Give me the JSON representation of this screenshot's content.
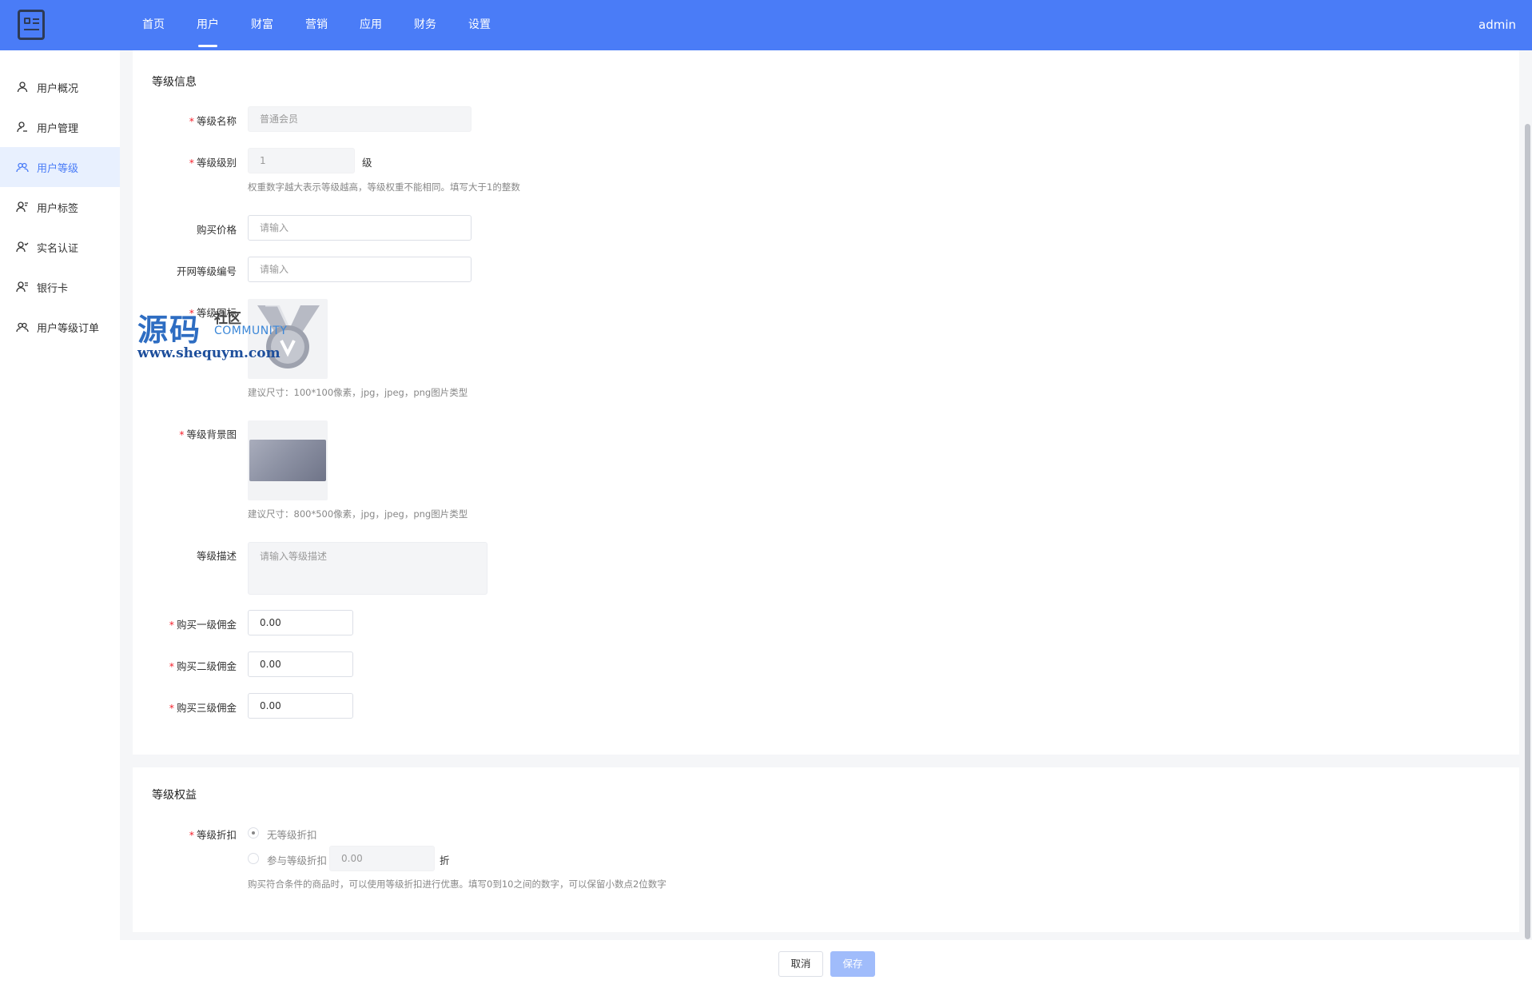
{
  "header": {
    "nav": [
      "首页",
      "用户",
      "财富",
      "营销",
      "应用",
      "财务",
      "设置"
    ],
    "active_nav": "用户",
    "user": "admin",
    "accent": "#4a7cf7"
  },
  "sidebar": {
    "items": [
      {
        "label": "用户概况",
        "icon": "user-icon"
      },
      {
        "label": "用户管理",
        "icon": "user-manage-icon"
      },
      {
        "label": "用户等级",
        "icon": "users-icon",
        "active": true
      },
      {
        "label": "用户标签",
        "icon": "user-tag-icon"
      },
      {
        "label": "实名认证",
        "icon": "user-verify-icon"
      },
      {
        "label": "银行卡",
        "icon": "bank-card-icon"
      },
      {
        "label": "用户等级订单",
        "icon": "users-order-icon"
      }
    ]
  },
  "level_info": {
    "title": "等级信息",
    "name_label": "等级名称",
    "name_value": "普通会员",
    "rank_label": "等级级别",
    "rank_value": "1",
    "rank_unit": "级",
    "rank_hint": "权重数字越大表示等级越高，等级权重不能相同。填写大于1的整数",
    "price_label": "购买价格",
    "price_placeholder": "请输入",
    "code_label": "开网等级编号",
    "code_placeholder": "请输入",
    "icon_label": "等级图标",
    "icon_hint": "建议尺寸：100*100像素，jpg，jpeg，png图片类型",
    "bg_label": "等级背景图",
    "bg_hint": "建议尺寸：800*500像素，jpg，jpeg，png图片类型",
    "desc_label": "等级描述",
    "desc_placeholder": "请输入等级描述",
    "commission1_label": "购买一级佣金",
    "commission1_value": "0.00",
    "commission2_label": "购买二级佣金",
    "commission2_value": "0.00",
    "commission3_label": "购买三级佣金",
    "commission3_value": "0.00"
  },
  "level_rights": {
    "title": "等级权益",
    "discount_label": "等级折扣",
    "option_none": "无等级折扣",
    "option_join": "参与等级折扣",
    "discount_value": "0.00",
    "discount_unit": "折",
    "discount_hint": "购买符合条件的商品时，可以使用等级折扣进行优惠。填写0到10之间的数字，可以保留小数点2位数字"
  },
  "watermark": {
    "big": "源码",
    "small1": "社区",
    "small2": "COMMUNITY",
    "url": "www.shequym.com"
  },
  "footer": {
    "cancel": "取消",
    "save": "保存"
  }
}
